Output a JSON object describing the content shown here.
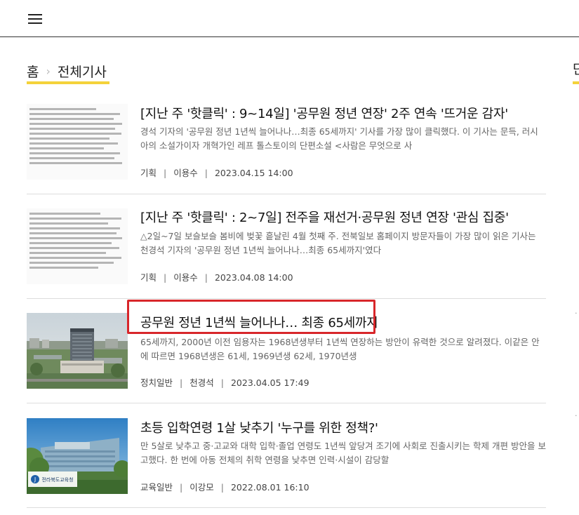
{
  "header": {
    "menu_icon": "hamburger-menu-icon"
  },
  "breadcrumb": {
    "home": "홈",
    "separator": "›",
    "current": "전체기사"
  },
  "sidebar_cut": {
    "heading_fragment": "단",
    "marker": "·"
  },
  "articles": [
    {
      "title": "[지난 주 '핫클릭' : 9~14일] '공무원 정년 연장' 2주 연속 '뜨거운 감자'",
      "summary": "경석 기자의 '공무원 정년 1년씩 늘어나나…최종 65세까지' 기사를 가장 많이 클릭했다. 이 기사는 문득, 러시아의 소설가이자 개혁가인 레프 톨스토이의 단편소설 <사람은 무엇으로 사",
      "category": "기획",
      "author": "이용수",
      "date": "2023.04.15 14:00",
      "thumbnail": "ranking-list-document-image"
    },
    {
      "title": "[지난 주 '핫클릭' : 2~7일] 전주을 재선거·공무원 정년 연장 '관심 집중'",
      "summary": "△2일~7일 보슬보슬 봄비에 벚꽃 흩날린 4월 첫째 주. 전북일보 홈페이지 방문자들이 가장 많이 읽은 기사는 천경석 기자의 '공무원 정년 1년씩 늘어나나…최종 65세까지'였다",
      "category": "기획",
      "author": "이용수",
      "date": "2023.04.08 14:00",
      "thumbnail": "ranking-list-document-image"
    },
    {
      "title": "공무원 정년 1년씩 늘어나나… 최종 65세까지",
      "summary": "65세까지, 2000년 이전 임용자는 1968년생부터 1년씩 연장하는 방안이 유력한 것으로 알려졌다. 이같은 안에 따르면 1968년생은 61세, 1969년생 62세, 1970년생",
      "category": "정치일반",
      "author": "천경석",
      "date": "2023.04.05 17:49",
      "thumbnail": "provincial-government-building-photo"
    },
    {
      "title": "초등 입학연령 1살 낮추기 '누구를 위한 정책?'",
      "summary": "만 5살로 낮추고 중·고교와 대학 입학·졸업 연령도 1년씩 앞당겨 조기에 사회로 진출시키는 학제 개편 방안을 보고했다. 한 번에 아동 전체의 취학 연령을 낮추면 인력·시설이 감당할",
      "category": "교육일반",
      "author": "이강모",
      "date": "2022.08.01 16:10",
      "thumbnail": "education-office-building-photo",
      "thumb_sign": "전라북도교육청"
    }
  ],
  "colors": {
    "accent": "#f4d23a",
    "highlight": "#d8262a"
  }
}
